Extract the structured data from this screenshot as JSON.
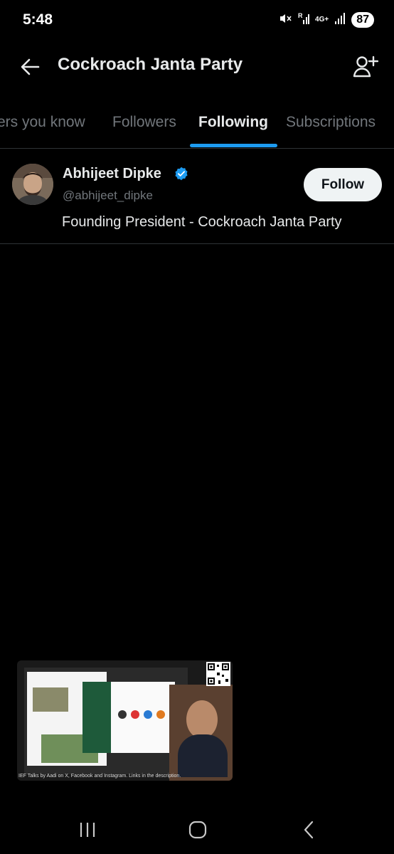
{
  "status_bar": {
    "time": "5:48",
    "network": "4G+",
    "battery": "87"
  },
  "header": {
    "title": "Cockroach Janta Party"
  },
  "tabs": [
    {
      "label": "Followers you know",
      "visible_label": "ers you know"
    },
    {
      "label": "Followers"
    },
    {
      "label": "Following",
      "active": true
    },
    {
      "label": "Subscriptions"
    }
  ],
  "users": [
    {
      "name": "Abhijeet Dipke",
      "handle": "@abhijeet_dipke",
      "bio": "Founding President - Cockroach Janta Party",
      "verified": true,
      "follow_label": "Follow"
    }
  ],
  "video_overlay": {
    "caption": "IEF Talks by Aadi on X, Facebook and Instagram. Links in the description."
  },
  "colors": {
    "background": "#000000",
    "accent": "#1d9bf0",
    "text_primary": "#e7e9ea",
    "text_secondary": "#71767b",
    "divider": "#2f3336",
    "button_bg": "#eff3f4"
  }
}
